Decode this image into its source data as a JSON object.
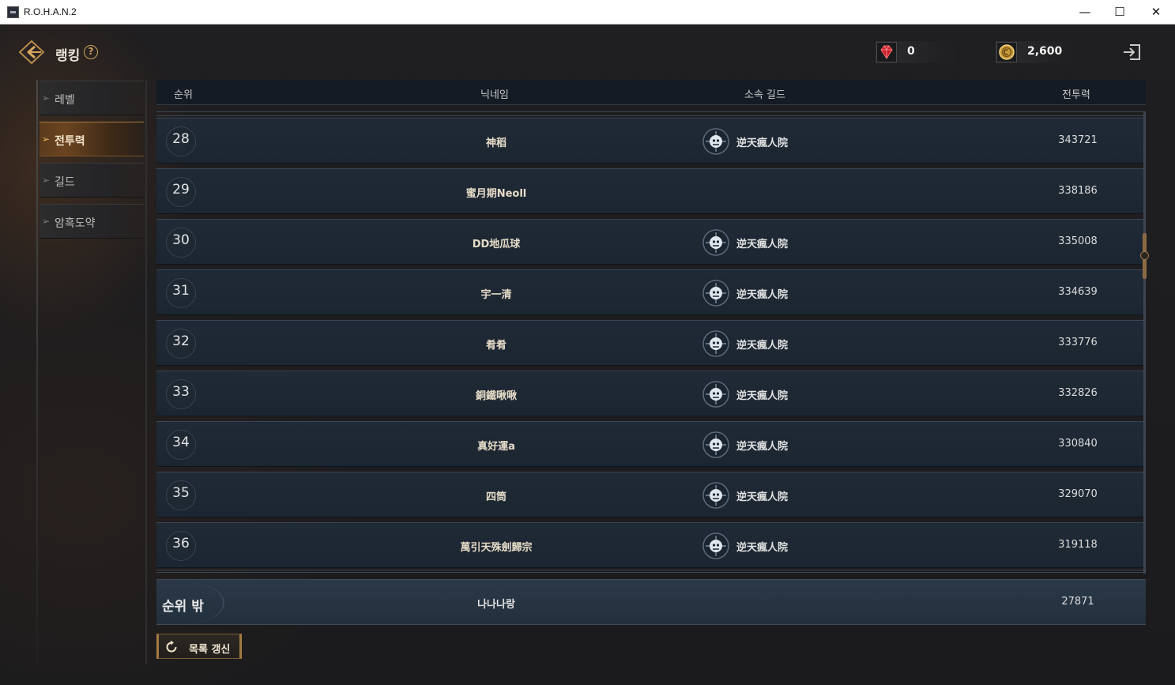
{
  "window": {
    "title": "R.O.H.A.N.2",
    "minimize": "—",
    "maximize": "☐",
    "close": "✕"
  },
  "header": {
    "title": "랭킹",
    "help": "?",
    "gem_count": "0",
    "gold_count": "2,600",
    "gem_color": "#c81e2e",
    "gold_color": "#c99a3a"
  },
  "sidebar": {
    "items": [
      {
        "label": "레벨",
        "active": false
      },
      {
        "label": "전투력",
        "active": true
      },
      {
        "label": "길드",
        "active": false
      },
      {
        "label": "암흑도약",
        "active": false
      }
    ]
  },
  "table": {
    "headers": {
      "rank": "순위",
      "nickname": "닉네임",
      "guild": "소속 길드",
      "power": "전투력"
    },
    "rows": [
      {
        "rank": "28",
        "nickname": "神稻",
        "guild": "逆天瘋人院",
        "power": "343721"
      },
      {
        "rank": "29",
        "nickname": "蜜月期Neoll",
        "guild": "",
        "power": "338186"
      },
      {
        "rank": "30",
        "nickname": "DD地瓜球",
        "guild": "逆天瘋人院",
        "power": "335008"
      },
      {
        "rank": "31",
        "nickname": "宇一清",
        "guild": "逆天瘋人院",
        "power": "334639"
      },
      {
        "rank": "32",
        "nickname": "肴肴",
        "guild": "逆天瘋人院",
        "power": "333776"
      },
      {
        "rank": "33",
        "nickname": "銅鐵啾啾",
        "guild": "逆天瘋人院",
        "power": "332826"
      },
      {
        "rank": "34",
        "nickname": "真好運a",
        "guild": "逆天瘋人院",
        "power": "330840"
      },
      {
        "rank": "35",
        "nickname": "四筒",
        "guild": "逆天瘋人院",
        "power": "329070"
      },
      {
        "rank": "36",
        "nickname": "萬引天殊劍歸宗",
        "guild": "逆天瘋人院",
        "power": "319118"
      }
    ]
  },
  "my_rank": {
    "rank": "순위 밖",
    "nickname": "나나나랑",
    "power": "27871"
  },
  "refresh_button": {
    "label": "목록 갱신"
  },
  "accent_color": "#a47a42"
}
